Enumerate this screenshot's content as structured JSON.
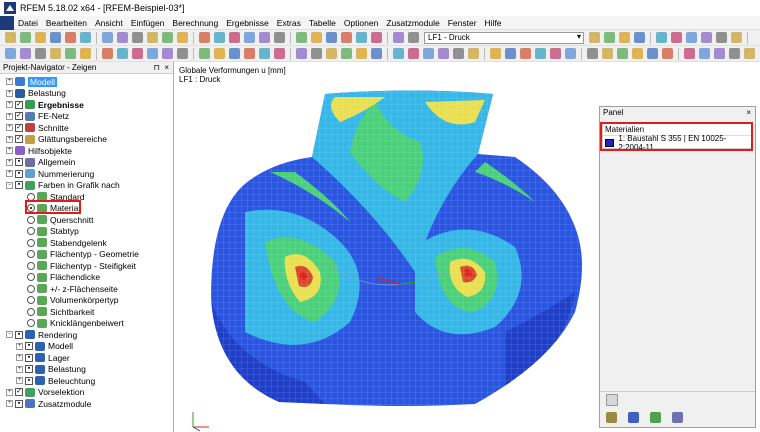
{
  "app": {
    "title": "RFEM 5.18.02 x64 - [RFEM-Beispiel-03*]",
    "menu": [
      "Datei",
      "Bearbeiten",
      "Ansicht",
      "Einfügen",
      "Berechnung",
      "Ergebnisse",
      "Extras",
      "Tabelle",
      "Optionen",
      "Zusatzmodule",
      "Fenster",
      "Hilfe"
    ],
    "load_case": "LF1 - Druck"
  },
  "navigator": {
    "title": "Projekt-Navigator - Zeigen",
    "pin": "⊓",
    "close": "×",
    "items": [
      {
        "label": "Modell",
        "selected": true
      },
      {
        "label": "Belastung"
      },
      {
        "label": "Ergebnisse",
        "bold": true
      },
      {
        "label": "FE-Netz"
      },
      {
        "label": "Schnitte"
      },
      {
        "label": "Glättungsbereiche"
      },
      {
        "label": "Hilfsobjekte"
      },
      {
        "label": "Allgemein"
      },
      {
        "label": "Nummerierung"
      },
      {
        "label": "Farben in Grafik nach"
      },
      {
        "label": "Standard"
      },
      {
        "label": "Material",
        "checked": true
      },
      {
        "label": "Querschnitt"
      },
      {
        "label": "Stabtyp"
      },
      {
        "label": "Stabendgelenk"
      },
      {
        "label": "Flächentyp - Geometrie"
      },
      {
        "label": "Flächentyp - Steifigkeit"
      },
      {
        "label": "Flächendicke"
      },
      {
        "label": "+/- z-Flächenseite"
      },
      {
        "label": "Volumenkörpertyp"
      },
      {
        "label": "Sichtbarkeit"
      },
      {
        "label": "Knicklängenbeiwert"
      },
      {
        "label": "Rendering"
      },
      {
        "label": "Modell"
      },
      {
        "label": "Lager"
      },
      {
        "label": "Belastung"
      },
      {
        "label": "Beleuchtung"
      },
      {
        "label": "Vorselektion"
      },
      {
        "label": "Zusatzmodule"
      }
    ]
  },
  "view": {
    "line1": "Globale Verformungen u [mm]",
    "line2": "LF1 : Druck"
  },
  "panel": {
    "title": "Panel",
    "close": "×",
    "materials_header": "Materialien",
    "material": "1: Baustahl S 355 | EN 10025-2:2004-11",
    "material_color": "#2222c8"
  },
  "colors": {
    "accent": "#3399ff",
    "highlight": "#e21a1a"
  }
}
